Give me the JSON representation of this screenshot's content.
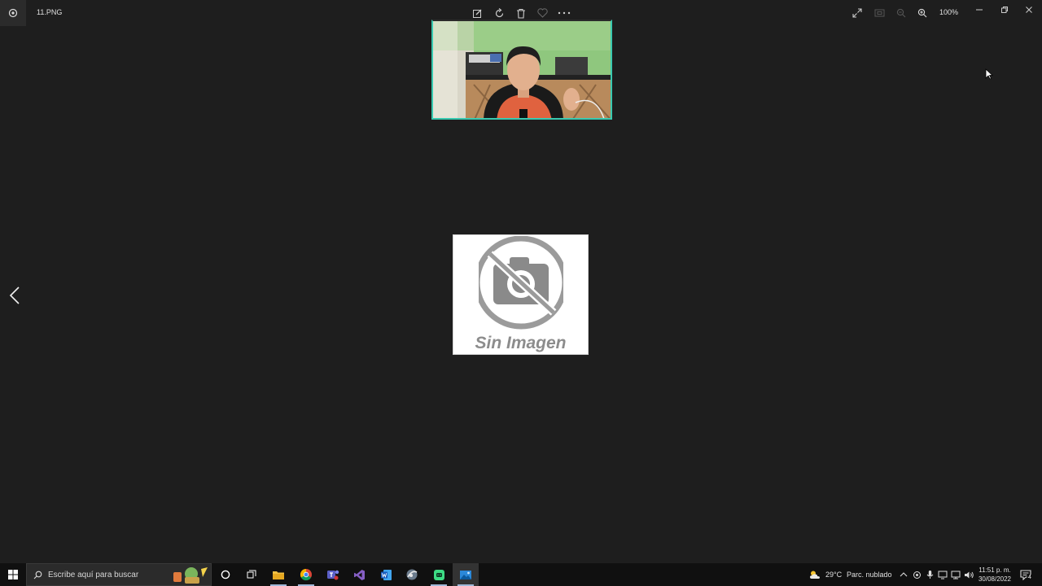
{
  "window": {
    "file_name": "11.PNG",
    "zoom_level": "100%",
    "toolbar_icons": [
      "edit-icon",
      "rotate-icon",
      "delete-icon",
      "favorite-icon",
      "more-icon"
    ],
    "view_icons": [
      "fullscreen-icon",
      "fit-icon",
      "zoom-out-icon",
      "zoom-in-icon"
    ]
  },
  "content": {
    "placeholder_label": "Sin Imagen"
  },
  "taskbar": {
    "search_placeholder": "Escribe aquí para buscar",
    "pinned_apps": [
      "cortana-icon",
      "task-view-icon",
      "file-explorer-icon",
      "chrome-icon",
      "teams-icon",
      "visual-studio-icon",
      "word-icon",
      "browser-icon",
      "android-studio-icon",
      "photos-icon"
    ],
    "weather": {
      "temperature": "29°C",
      "condition": "Parc. nublado"
    },
    "clock": {
      "time": "11:51 p. m.",
      "date": "30/08/2022"
    },
    "notification_count": "4"
  },
  "colors": {
    "background": "#1e1e1e",
    "accent": "#39c9b0",
    "taskbar": "#101010"
  }
}
